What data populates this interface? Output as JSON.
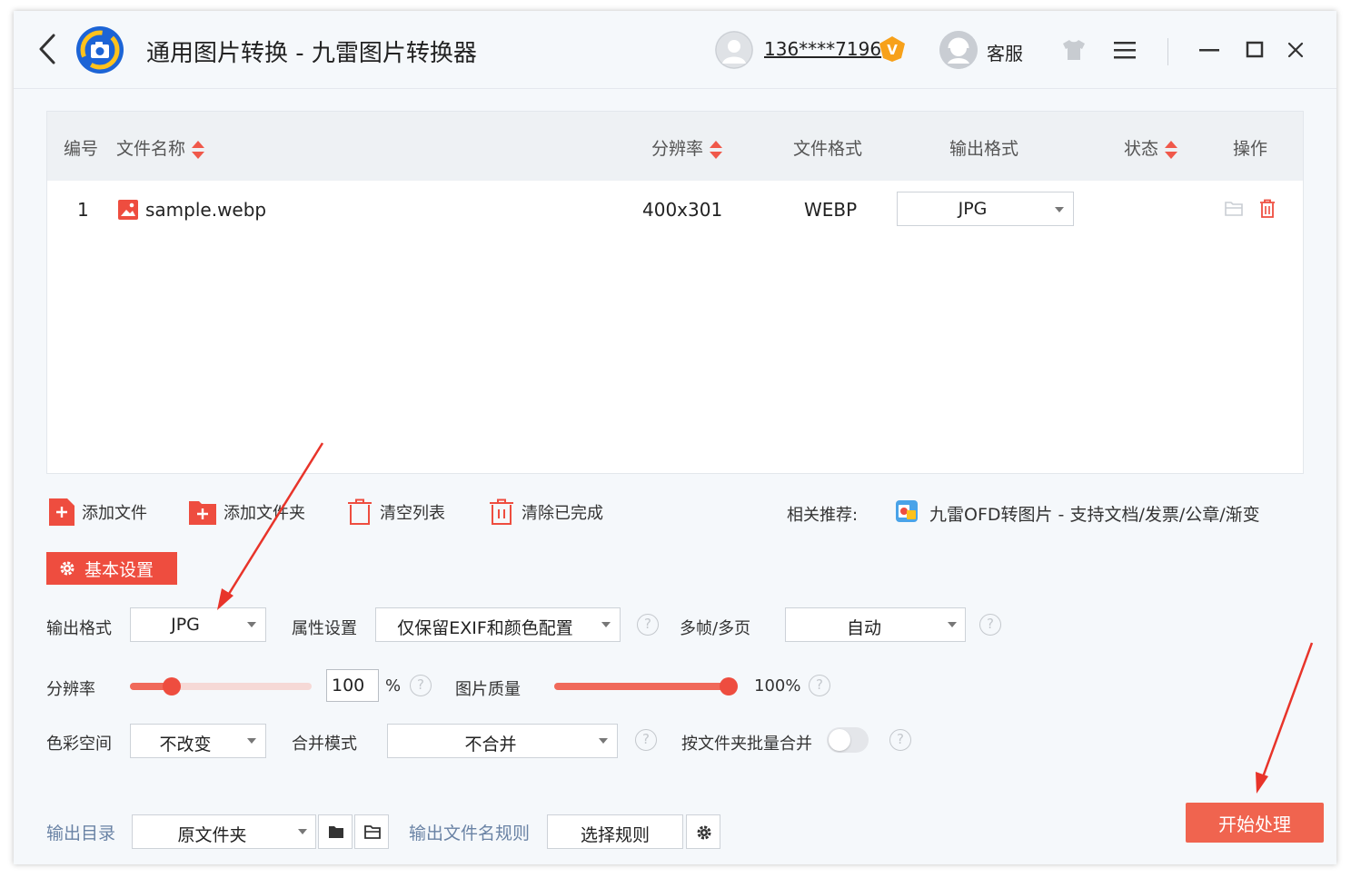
{
  "titlebar": {
    "title": "通用图片转换 - 九雷图片转换器",
    "phone": "136****7196",
    "vip_badge": "V",
    "service": "客服",
    "colors": {
      "logo_blue": "#1c64d6",
      "logo_yellow": "#ffc21c",
      "vip_orange": "#f7a11a"
    }
  },
  "table": {
    "headers": {
      "index": "编号",
      "filename": "文件名称",
      "resolution": "分辨率",
      "file_format": "文件格式",
      "output_format": "输出格式",
      "status": "状态",
      "action": "操作"
    },
    "rows": [
      {
        "index": "1",
        "filename": "sample.webp",
        "resolution": "400x301",
        "file_format": "WEBP",
        "output_format": "JPG",
        "status": ""
      }
    ]
  },
  "toolbar": {
    "add_file": "添加文件",
    "add_folder": "添加文件夹",
    "clear_list": "清空列表",
    "clear_done": "清除已完成",
    "recommend_label": "相关推荐:",
    "recommend_link": "九雷OFD转图片 - 支持文档/发票/公章/渐变"
  },
  "settings": {
    "tab": "基本设置",
    "output_format_label": "输出格式",
    "output_format_value": "JPG",
    "attr_label": "属性设置",
    "attr_value": "仅保留EXIF和颜色配置",
    "multiframe_label": "多帧/多页",
    "multiframe_value": "自动",
    "resolution_label": "分辨率",
    "resolution_value": "100",
    "resolution_unit": "%",
    "resolution_slider_fraction": 0.23,
    "quality_label": "图片质量",
    "quality_value": "100%",
    "quality_fraction": 1.0,
    "colorspace_label": "色彩空间",
    "colorspace_value": "不改变",
    "merge_label": "合并模式",
    "merge_value": "不合并",
    "folder_merge_label": "按文件夹批量合并",
    "folder_merge_on": false,
    "help_glyph": "?",
    "accent": "#ee4d3f"
  },
  "bottom": {
    "output_dir_label": "输出目录",
    "output_dir_value": "原文件夹",
    "filename_rule_label": "输出文件名规则",
    "choose_rule": "选择规则",
    "start": "开始处理"
  }
}
